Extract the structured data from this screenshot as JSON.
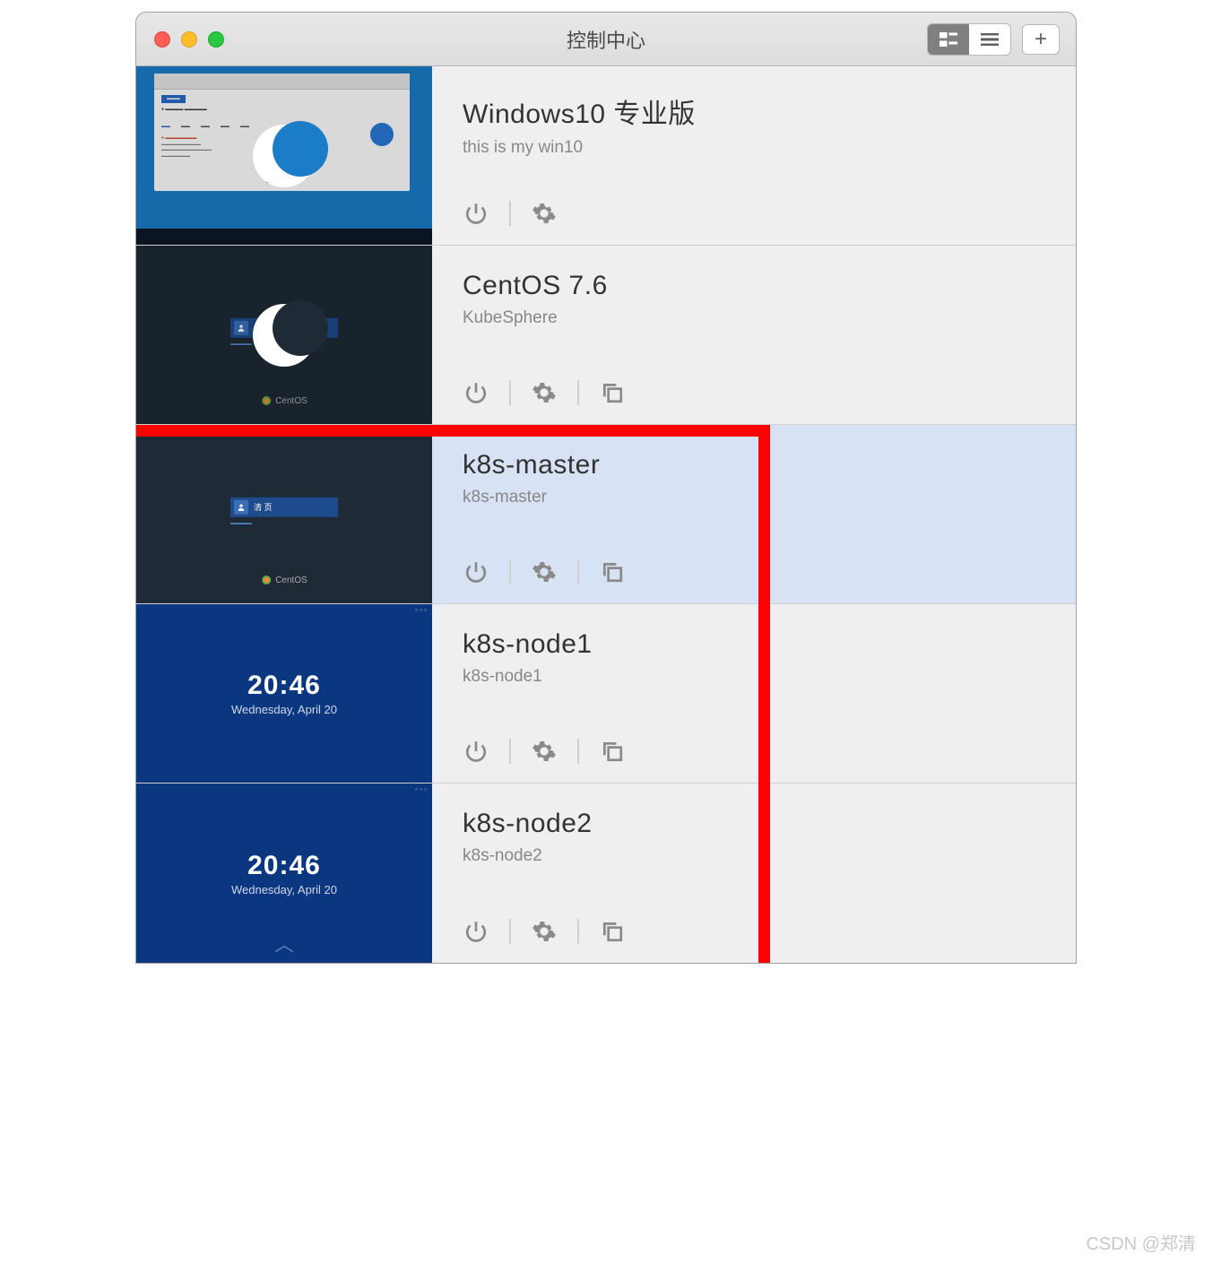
{
  "window": {
    "title": "控制中心"
  },
  "vms": [
    {
      "title": "Windows10 专业版",
      "subtitle": "this is my win10",
      "thumb_type": "win10",
      "suspended": true,
      "actions": [
        "power",
        "settings"
      ]
    },
    {
      "title": "CentOS 7.6",
      "subtitle": "KubeSphere",
      "thumb_type": "centos_dark",
      "suspended": true,
      "actions": [
        "power",
        "settings",
        "clone"
      ],
      "centos_label": "CentOS"
    },
    {
      "title": "k8s-master",
      "subtitle": "k8s-master",
      "thumb_type": "centos_dark_login",
      "selected": true,
      "actions": [
        "power",
        "settings",
        "clone"
      ],
      "login_label": "清 页",
      "centos_label": "CentOS"
    },
    {
      "title": "k8s-node1",
      "subtitle": "k8s-node1",
      "thumb_type": "centos_blue",
      "actions": [
        "power",
        "settings",
        "clone"
      ],
      "time": "20:46",
      "date": "Wednesday, April 20"
    },
    {
      "title": "k8s-node2",
      "subtitle": "k8s-node2",
      "thumb_type": "centos_blue",
      "actions": [
        "power",
        "settings",
        "clone"
      ],
      "time": "20:46",
      "date": "Wednesday, April 20"
    }
  ],
  "watermark": "CSDN @郑清"
}
